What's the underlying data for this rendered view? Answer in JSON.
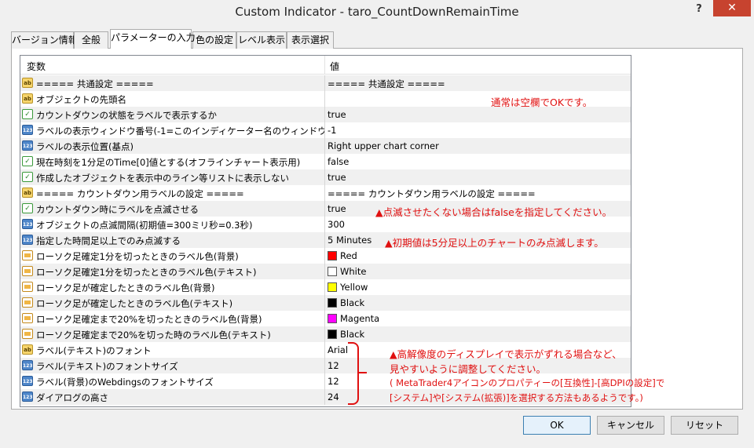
{
  "window": {
    "title": "Custom Indicator - taro_CountDownRemainTime",
    "help": "?",
    "close": "✕"
  },
  "tabs": [
    "バージョン情報",
    "全般",
    "パラメーターの入力",
    "色の設定",
    "レベル表示",
    "表示選択"
  ],
  "grid": {
    "col_variable": "変数",
    "col_value": "値",
    "rows": [
      {
        "icon": "ab",
        "label": "===== 共通設定 =====",
        "value": "===== 共通設定 ====="
      },
      {
        "icon": "ab",
        "label": "オブジェクトの先頭名",
        "value": ""
      },
      {
        "icon": "bool",
        "label": "カウントダウンの状態をラベルで表示するか",
        "value": "true"
      },
      {
        "icon": "num",
        "label": "ラベルの表示ウィンドウ番号(-1=このインディケーター名のウィンドウ)",
        "value": "-1"
      },
      {
        "icon": "num",
        "label": "ラベルの表示位置(基点)",
        "value": "Right upper chart corner"
      },
      {
        "icon": "bool",
        "label": "現在時刻を1分足のTime[0]値とする(オフラインチャート表示用)",
        "value": "false"
      },
      {
        "icon": "bool",
        "label": "作成したオブジェクトを表示中のライン等リストに表示しない",
        "value": "true"
      },
      {
        "icon": "ab",
        "label": "===== カウントダウン用ラベルの設定 =====",
        "value": "===== カウントダウン用ラベルの設定 ====="
      },
      {
        "icon": "bool",
        "label": "カウントダウン時にラベルを点滅させる",
        "value": "true"
      },
      {
        "icon": "num",
        "label": "オブジェクトの点滅間隔(初期値=300ミリ秒=0.3秒)",
        "value": "300"
      },
      {
        "icon": "num",
        "label": "指定した時間足以上でのみ点滅する",
        "value": "5 Minutes"
      },
      {
        "icon": "col",
        "label": "ローソク足確定1分を切ったときのラベル色(背景)",
        "value": "Red",
        "swatch": "#ff0000"
      },
      {
        "icon": "col",
        "label": "ローソク足確定1分を切ったときのラベル色(テキスト)",
        "value": "White",
        "swatch": "#ffffff"
      },
      {
        "icon": "col",
        "label": "ローソク足が確定したときのラベル色(背景)",
        "value": "Yellow",
        "swatch": "#ffff00"
      },
      {
        "icon": "col",
        "label": "ローソク足が確定したときのラベル色(テキスト)",
        "value": "Black",
        "swatch": "#000000"
      },
      {
        "icon": "col",
        "label": "ローソク足確定まで20%を切ったときのラベル色(背景)",
        "value": "Magenta",
        "swatch": "#ff00ff"
      },
      {
        "icon": "col",
        "label": "ローソク足確定まで20%を切った時のラベル色(テキスト)",
        "value": "Black",
        "swatch": "#000000"
      },
      {
        "icon": "ab",
        "label": "ラベル(テキスト)のフォント",
        "value": "Arial"
      },
      {
        "icon": "num",
        "label": "ラベル(テキスト)のフォントサイズ",
        "value": "12"
      },
      {
        "icon": "num",
        "label": "ラベル(背景)のWebdingsのフォントサイズ",
        "value": "12"
      },
      {
        "icon": "num",
        "label": "ダイアログの高さ",
        "value": "24"
      }
    ]
  },
  "notes": {
    "prefix": "通常は空欄でOKです。",
    "blink": "▲点滅させたくない場合はfalseを指定してください。",
    "minutes": "▲初期値は5分足以上のチャートのみ点滅します。",
    "dpi1": "▲高解像度のディスプレイで表示がずれる場合など、",
    "dpi2": "見やすいように調整してください。",
    "dpi3": "( MetaTrader4アイコンのプロパティーの[互換性]-[高DPIの設定]で",
    "dpi4": "[システム]や[システム(拡張)]を選択する方法もあるようです。)"
  },
  "buttons": {
    "ok": "OK",
    "cancel": "キャンセル",
    "reset": "リセット"
  },
  "icon_names": {
    "ab": "string-type-icon",
    "num": "number-type-icon",
    "bool": "boolean-type-icon",
    "col": "color-type-icon"
  },
  "icon_glyphs": {
    "ab": "ab",
    "num": "123",
    "bool": "✓",
    "col": ""
  }
}
